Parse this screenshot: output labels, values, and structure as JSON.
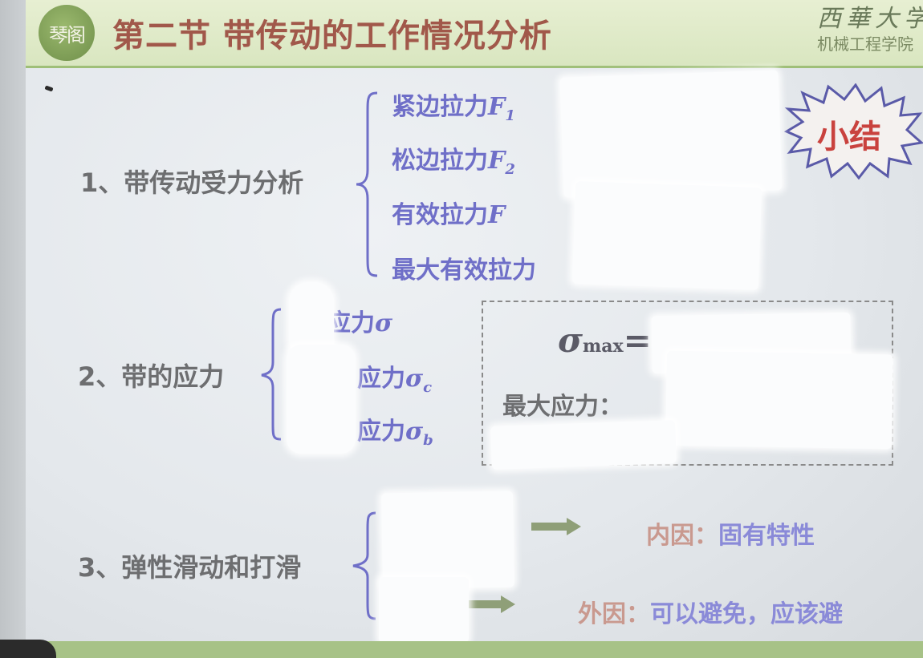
{
  "slide": {
    "logo_text": "琴阁",
    "title": "第二节  带传动的工作情况分析",
    "university_script": "西華大学",
    "department": "机械工程学院",
    "summary_badge": "小结"
  },
  "section1": {
    "heading": "1、带传动受力分析",
    "items": [
      {
        "text": "紧边拉力",
        "symbol": "F",
        "sub": "1"
      },
      {
        "text": "松边拉力",
        "symbol": "F",
        "sub": "2"
      },
      {
        "text": "有效拉力",
        "symbol": "F",
        "sub": ""
      },
      {
        "text": "最大有效拉力",
        "symbol": "",
        "sub": ""
      }
    ]
  },
  "section2": {
    "heading": "2、带的应力",
    "items": [
      {
        "text": "应力",
        "symbol": "σ",
        "sub": ""
      },
      {
        "text": "应力",
        "symbol": "σ",
        "sub": "c"
      },
      {
        "text": "应力",
        "symbol": "σ",
        "sub": "b"
      }
    ],
    "formula_symbol": "σ",
    "formula_sub": "max",
    "formula_eq": "=",
    "max_stress_label": "最大应力："
  },
  "section3": {
    "heading": "3、弹性滑动和打滑",
    "internal_key": "内因：",
    "internal_value": "固有特性",
    "external_key": "外因：",
    "external_value": "可以避免，应该避"
  },
  "colors": {
    "title": "#a1584a",
    "heading": "#6d6e70",
    "item": "#6f6fc8",
    "summary": "#c9423e",
    "arrow": "#8f9f78"
  }
}
